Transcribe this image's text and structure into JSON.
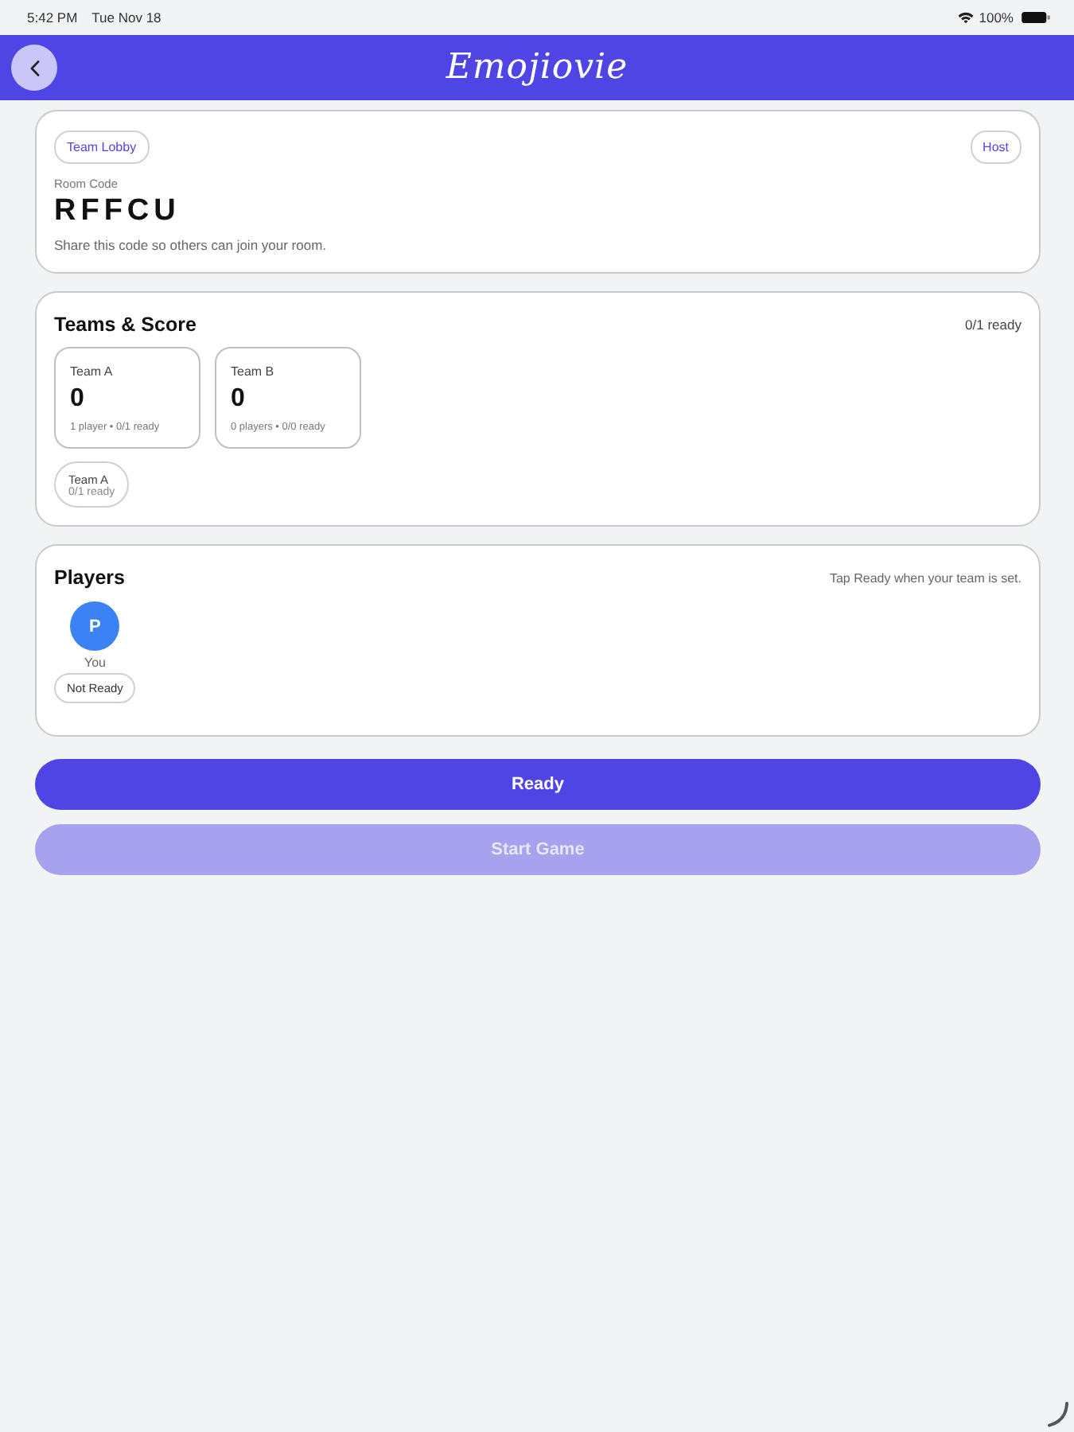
{
  "status_bar": {
    "time": "5:42 PM",
    "date": "Tue Nov 18",
    "battery": "100%"
  },
  "header": {
    "title": "Emojiovie"
  },
  "lobby_card": {
    "tag": "Team Lobby",
    "role": "Host",
    "room_code_label": "Room Code",
    "room_code": "RFFCU",
    "hint": "Share this code so others can join your room."
  },
  "teams_card": {
    "title": "Teams & Score",
    "ready_count": "0/1 ready",
    "teams": [
      {
        "name": "Team A",
        "score": "0",
        "summary": "1 player • 0/1 ready"
      },
      {
        "name": "Team B",
        "score": "0",
        "summary": "0 players • 0/0 ready"
      }
    ],
    "my_team": {
      "name": "Team A",
      "status": "0/1 ready"
    }
  },
  "players_card": {
    "title": "Players",
    "hint": "Tap Ready when your team is set.",
    "players": [
      {
        "initial": "P",
        "name": "You",
        "status": "Not Ready"
      }
    ]
  },
  "buttons": [
    {
      "label": "Ready",
      "disabled": false
    },
    {
      "label": "Start Game",
      "disabled": true
    }
  ]
}
